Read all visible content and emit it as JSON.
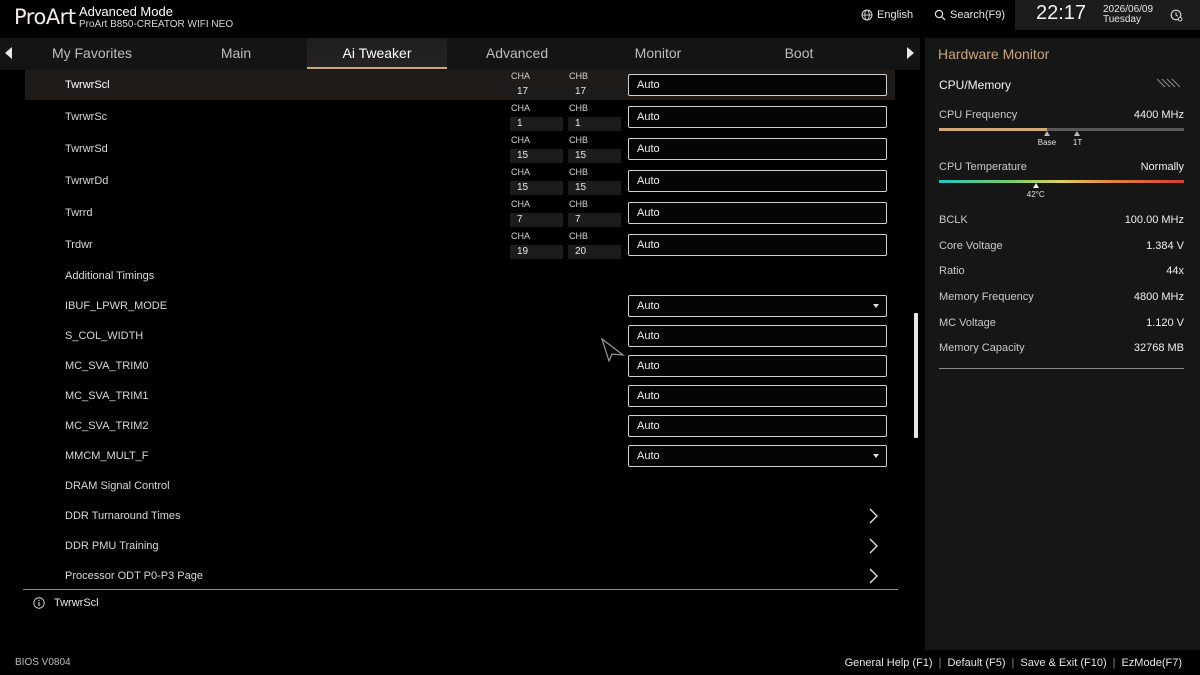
{
  "header": {
    "logo": "ProArt",
    "mode": "Advanced Mode",
    "board": "ProArt B850-CREATOR WIFI NEO",
    "language": "English",
    "search": "Search(F9)",
    "time": "22:17",
    "date": "2026/06/09",
    "weekday": "Tuesday"
  },
  "tabs": [
    {
      "label": "My Favorites"
    },
    {
      "label": "Main"
    },
    {
      "label": "Ai Tweaker",
      "active": true
    },
    {
      "label": "Advanced"
    },
    {
      "label": "Monitor"
    },
    {
      "label": "Boot"
    }
  ],
  "channel_labels": {
    "a": "CHA",
    "b": "CHB"
  },
  "rows": [
    {
      "label": "TwrwrScl",
      "cha": "17",
      "chb": "17",
      "value": "Auto",
      "selected": true
    },
    {
      "label": "TwrwrSc",
      "cha": "1",
      "chb": "1",
      "value": "Auto"
    },
    {
      "label": "TwrwrSd",
      "cha": "15",
      "chb": "15",
      "value": "Auto"
    },
    {
      "label": "TwrwrDd",
      "cha": "15",
      "chb": "15",
      "value": "Auto"
    },
    {
      "label": "Twrrd",
      "cha": "7",
      "chb": "7",
      "value": "Auto"
    },
    {
      "label": "Trdwr",
      "cha": "19",
      "chb": "20",
      "value": "Auto"
    },
    {
      "label": "Additional Timings"
    },
    {
      "label": "IBUF_LPWR_MODE",
      "value": "Auto",
      "dropdown": true
    },
    {
      "label": "S_COL_WIDTH",
      "value": "Auto"
    },
    {
      "label": "MC_SVA_TRIM0",
      "value": "Auto"
    },
    {
      "label": "MC_SVA_TRIM1",
      "value": "Auto"
    },
    {
      "label": "MC_SVA_TRIM2",
      "value": "Auto"
    },
    {
      "label": "MMCM_MULT_F",
      "value": "Auto",
      "dropdown": true
    },
    {
      "label": "DRAM Signal Control"
    },
    {
      "label": "DDR Turnaround Times",
      "submenu": true
    },
    {
      "label": "DDR PMU Training",
      "submenu": true
    },
    {
      "label": "Processor ODT P0-P3 Page",
      "submenu": true
    }
  ],
  "help_text": "TwrwrScl",
  "hardware_monitor": {
    "title": "Hardware Monitor",
    "section": "CPU/Memory",
    "cpu_frequency": {
      "label": "CPU Frequency",
      "value": "4400 MHz",
      "level": 0.44,
      "base_label": "Base",
      "base_level": 0.44,
      "onet_label": "1T",
      "onet_level": 0.565
    },
    "cpu_temperature": {
      "label": "CPU Temperature",
      "value": "Normally",
      "marker_label": "42°C",
      "level": 0.395
    },
    "stats": [
      {
        "label": "BCLK",
        "value": "100.00 MHz"
      },
      {
        "label": "Core Voltage",
        "value": "1.384 V"
      },
      {
        "label": "Ratio",
        "value": "44x"
      },
      {
        "label": "Memory Frequency",
        "value": "4800 MHz"
      },
      {
        "label": "MC Voltage",
        "value": "1.120 V"
      },
      {
        "label": "Memory Capacity",
        "value": "32768 MB"
      }
    ]
  },
  "footer": {
    "version": "BIOS V0804",
    "keys": [
      "General Help (F1)",
      "Default (F5)",
      "Save & Exit (F10)",
      "EzMode(F7)"
    ]
  },
  "colors": {
    "accent": "#c9a57a",
    "panel": "#161616",
    "selected_row": "#1f1b19"
  }
}
